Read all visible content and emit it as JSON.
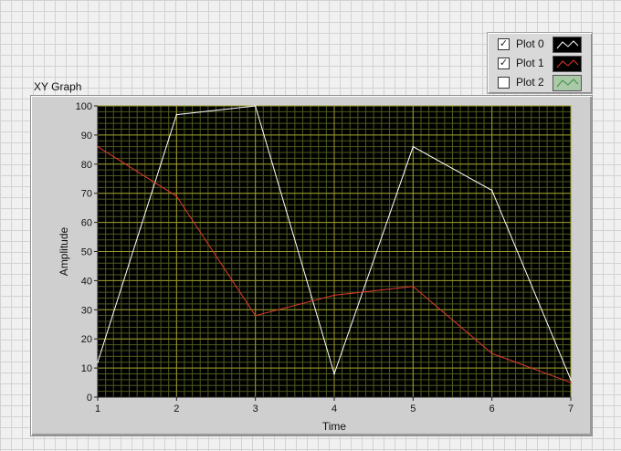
{
  "graph": {
    "title": "XY Graph"
  },
  "legend": {
    "items": [
      {
        "label": "Plot 0",
        "checked": true,
        "check": "✓",
        "color": "#ffffff"
      },
      {
        "label": "Plot 1",
        "checked": true,
        "check": "✓",
        "color": "#e03a2e"
      },
      {
        "label": "Plot 2",
        "checked": false,
        "check": "",
        "color": "#88cc88"
      }
    ]
  },
  "colors": {
    "plot_background": "#000000",
    "grid": "#9a9a2a",
    "grid_minor": "#4d5a1f"
  },
  "chart_data": {
    "type": "line",
    "xlabel": "Time",
    "ylabel": "Amplitude",
    "xlim": [
      1,
      7
    ],
    "ylim": [
      0,
      100
    ],
    "x_ticks": [
      1,
      2,
      3,
      4,
      5,
      6,
      7
    ],
    "y_ticks": [
      0,
      10,
      20,
      30,
      40,
      50,
      60,
      70,
      80,
      90,
      100
    ],
    "grid": true,
    "series": [
      {
        "name": "Plot 0",
        "color": "#ffffff",
        "x": [
          1,
          2,
          3,
          4,
          5,
          6,
          7
        ],
        "y": [
          12,
          97,
          100,
          8,
          86,
          71,
          6
        ]
      },
      {
        "name": "Plot 1",
        "color": "#e03a2e",
        "x": [
          1,
          2,
          3,
          4,
          5,
          6,
          7
        ],
        "y": [
          86,
          69,
          28,
          35,
          38,
          15,
          5
        ]
      }
    ]
  }
}
